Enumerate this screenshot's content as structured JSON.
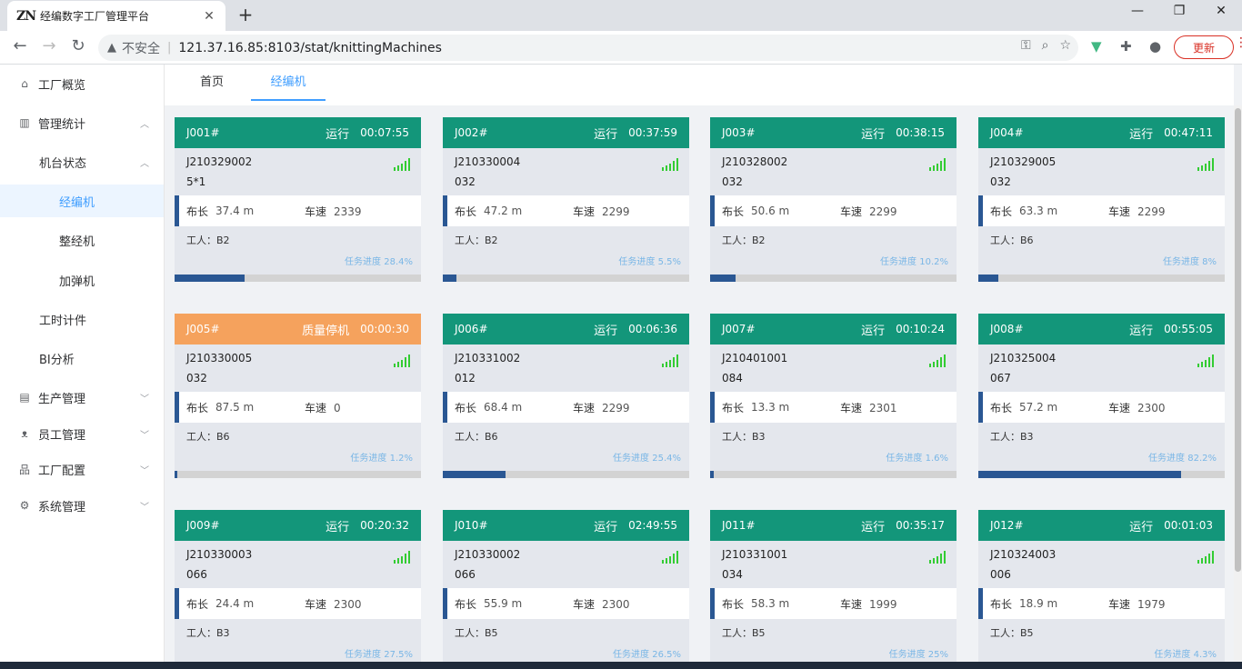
{
  "browser": {
    "tab_title": "经编数字工厂管理平台",
    "tab_favicon": "ZN",
    "new_tab": "+",
    "insecure_label": "不安全",
    "url": "121.37.16.85:8103/stat/knittingMachines",
    "update_label": "更新",
    "icons": [
      "back-icon",
      "forward-icon",
      "reload-icon",
      "key-icon",
      "zoom-icon",
      "star-icon",
      "vue-devtools-icon",
      "puzzle-icon",
      "profile-icon",
      "kebab-icon"
    ]
  },
  "sidebar": {
    "items": [
      {
        "label": "工厂概览",
        "icon": "home-icon"
      },
      {
        "label": "管理统计",
        "icon": "chart-icon"
      },
      {
        "label": "机台状态"
      },
      {
        "label": "经编机"
      },
      {
        "label": "整经机"
      },
      {
        "label": "加弹机"
      },
      {
        "label": "工时计件"
      },
      {
        "label": "BI分析"
      },
      {
        "label": "生产管理",
        "icon": "clipboard-icon"
      },
      {
        "label": "员工管理",
        "icon": "user-icon"
      },
      {
        "label": "工厂配置",
        "icon": "sitemap-icon"
      },
      {
        "label": "系统管理",
        "icon": "gear-icon"
      }
    ],
    "active": "经编机"
  },
  "page_tabs": [
    {
      "label": "首页"
    },
    {
      "label": "经编机"
    }
  ],
  "labels": {
    "length": "布长",
    "speed": "车速",
    "worker": "工人：",
    "progress": "任务进度"
  },
  "colors": {
    "running": "#13967a",
    "quality_stop": "#f5a25d",
    "bar_fill": "#2a5793",
    "signal": "#33cc33"
  },
  "machines": [
    {
      "id": "J001#",
      "status": "运行",
      "time": "00:07:55",
      "order": "J210329002",
      "code": "5*1",
      "length": "37.4 m",
      "speed": "2339",
      "worker": "B2",
      "progress_text": "任务进度 28.4%",
      "progress": 28.4
    },
    {
      "id": "J002#",
      "status": "运行",
      "time": "00:37:59",
      "order": "J210330004",
      "code": "032",
      "length": "47.2 m",
      "speed": "2299",
      "worker": "B2",
      "progress_text": "任务进度 5.5%",
      "progress": 5.5
    },
    {
      "id": "J003#",
      "status": "运行",
      "time": "00:38:15",
      "order": "J210328002",
      "code": "032",
      "length": "50.6 m",
      "speed": "2299",
      "worker": "B2",
      "progress_text": "任务进度 10.2%",
      "progress": 10.2
    },
    {
      "id": "J004#",
      "status": "运行",
      "time": "00:47:11",
      "order": "J210329005",
      "code": "032",
      "length": "63.3 m",
      "speed": "2299",
      "worker": "B6",
      "progress_text": "任务进度 8%",
      "progress": 8
    },
    {
      "id": "J005#",
      "status": "质量停机",
      "time": "00:00:30",
      "order": "J210330005",
      "code": "032",
      "length": "87.5 m",
      "speed": "0",
      "worker": "B6",
      "progress_text": "任务进度 1.2%",
      "progress": 1.2
    },
    {
      "id": "J006#",
      "status": "运行",
      "time": "00:06:36",
      "order": "J210331002",
      "code": "012",
      "length": "68.4 m",
      "speed": "2299",
      "worker": "B6",
      "progress_text": "任务进度 25.4%",
      "progress": 25.4
    },
    {
      "id": "J007#",
      "status": "运行",
      "time": "00:10:24",
      "order": "J210401001",
      "code": "084",
      "length": "13.3 m",
      "speed": "2301",
      "worker": "B3",
      "progress_text": "任务进度 1.6%",
      "progress": 1.6
    },
    {
      "id": "J008#",
      "status": "运行",
      "time": "00:55:05",
      "order": "J210325004",
      "code": "067",
      "length": "57.2 m",
      "speed": "2300",
      "worker": "B3",
      "progress_text": "任务进度 82.2%",
      "progress": 82.2
    },
    {
      "id": "J009#",
      "status": "运行",
      "time": "00:20:32",
      "order": "J210330003",
      "code": "066",
      "length": "24.4 m",
      "speed": "2300",
      "worker": "B3",
      "progress_text": "任务进度 27.5%",
      "progress": 27.5
    },
    {
      "id": "J010#",
      "status": "运行",
      "time": "02:49:55",
      "order": "J210330002",
      "code": "066",
      "length": "55.9 m",
      "speed": "2300",
      "worker": "B5",
      "progress_text": "任务进度 26.5%",
      "progress": 26.5
    },
    {
      "id": "J011#",
      "status": "运行",
      "time": "00:35:17",
      "order": "J210331001",
      "code": "034",
      "length": "58.3 m",
      "speed": "1999",
      "worker": "B5",
      "progress_text": "任务进度 25%",
      "progress": 25
    },
    {
      "id": "J012#",
      "status": "运行",
      "time": "00:01:03",
      "order": "J210324003",
      "code": "006",
      "length": "18.9 m",
      "speed": "1979",
      "worker": "B5",
      "progress_text": "任务进度 4.3%",
      "progress": 4.3
    }
  ]
}
